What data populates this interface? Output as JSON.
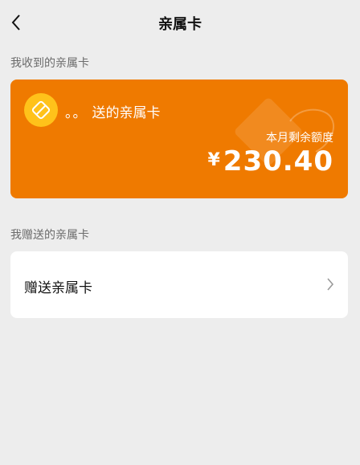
{
  "header": {
    "title": "亲属卡"
  },
  "received": {
    "section_label": "我收到的亲属卡",
    "card": {
      "sender_dots": "。。",
      "sender_suffix": "送的亲属卡",
      "quota_label": "本月剩余额度",
      "currency": "¥",
      "amount": "230.40"
    }
  },
  "sent": {
    "section_label": "我赠送的亲属卡",
    "item_label": "赠送亲属卡"
  },
  "colors": {
    "card": "#ef7a00",
    "logo": "#ffc21a",
    "background": "#ededed"
  },
  "icons": {
    "back": "chevron-left-icon",
    "logo": "family-card-logo-icon",
    "arrow": "chevron-right-icon"
  }
}
